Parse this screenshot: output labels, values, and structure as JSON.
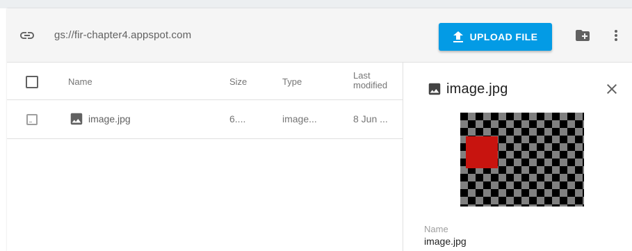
{
  "toolbar": {
    "bucket_path": "gs://fir-chapter4.appspot.com",
    "upload_label": "UPLOAD FILE",
    "accent_color": "#039be5",
    "icons": [
      "link-icon",
      "upload-icon",
      "new-folder-icon",
      "more-vert-icon"
    ]
  },
  "table": {
    "columns": [
      "Name",
      "Size",
      "Type",
      "Last modified"
    ],
    "rows": [
      {
        "name": "image.jpg",
        "size": "6....",
        "type": "image...",
        "last_modified": "8 Jun ...",
        "icon": "image-icon"
      }
    ]
  },
  "details": {
    "title": "image.jpg",
    "icon": "image-icon",
    "preview_icon": "preview-image",
    "fields": [
      {
        "label": "Name",
        "value": "image.jpg"
      }
    ]
  }
}
